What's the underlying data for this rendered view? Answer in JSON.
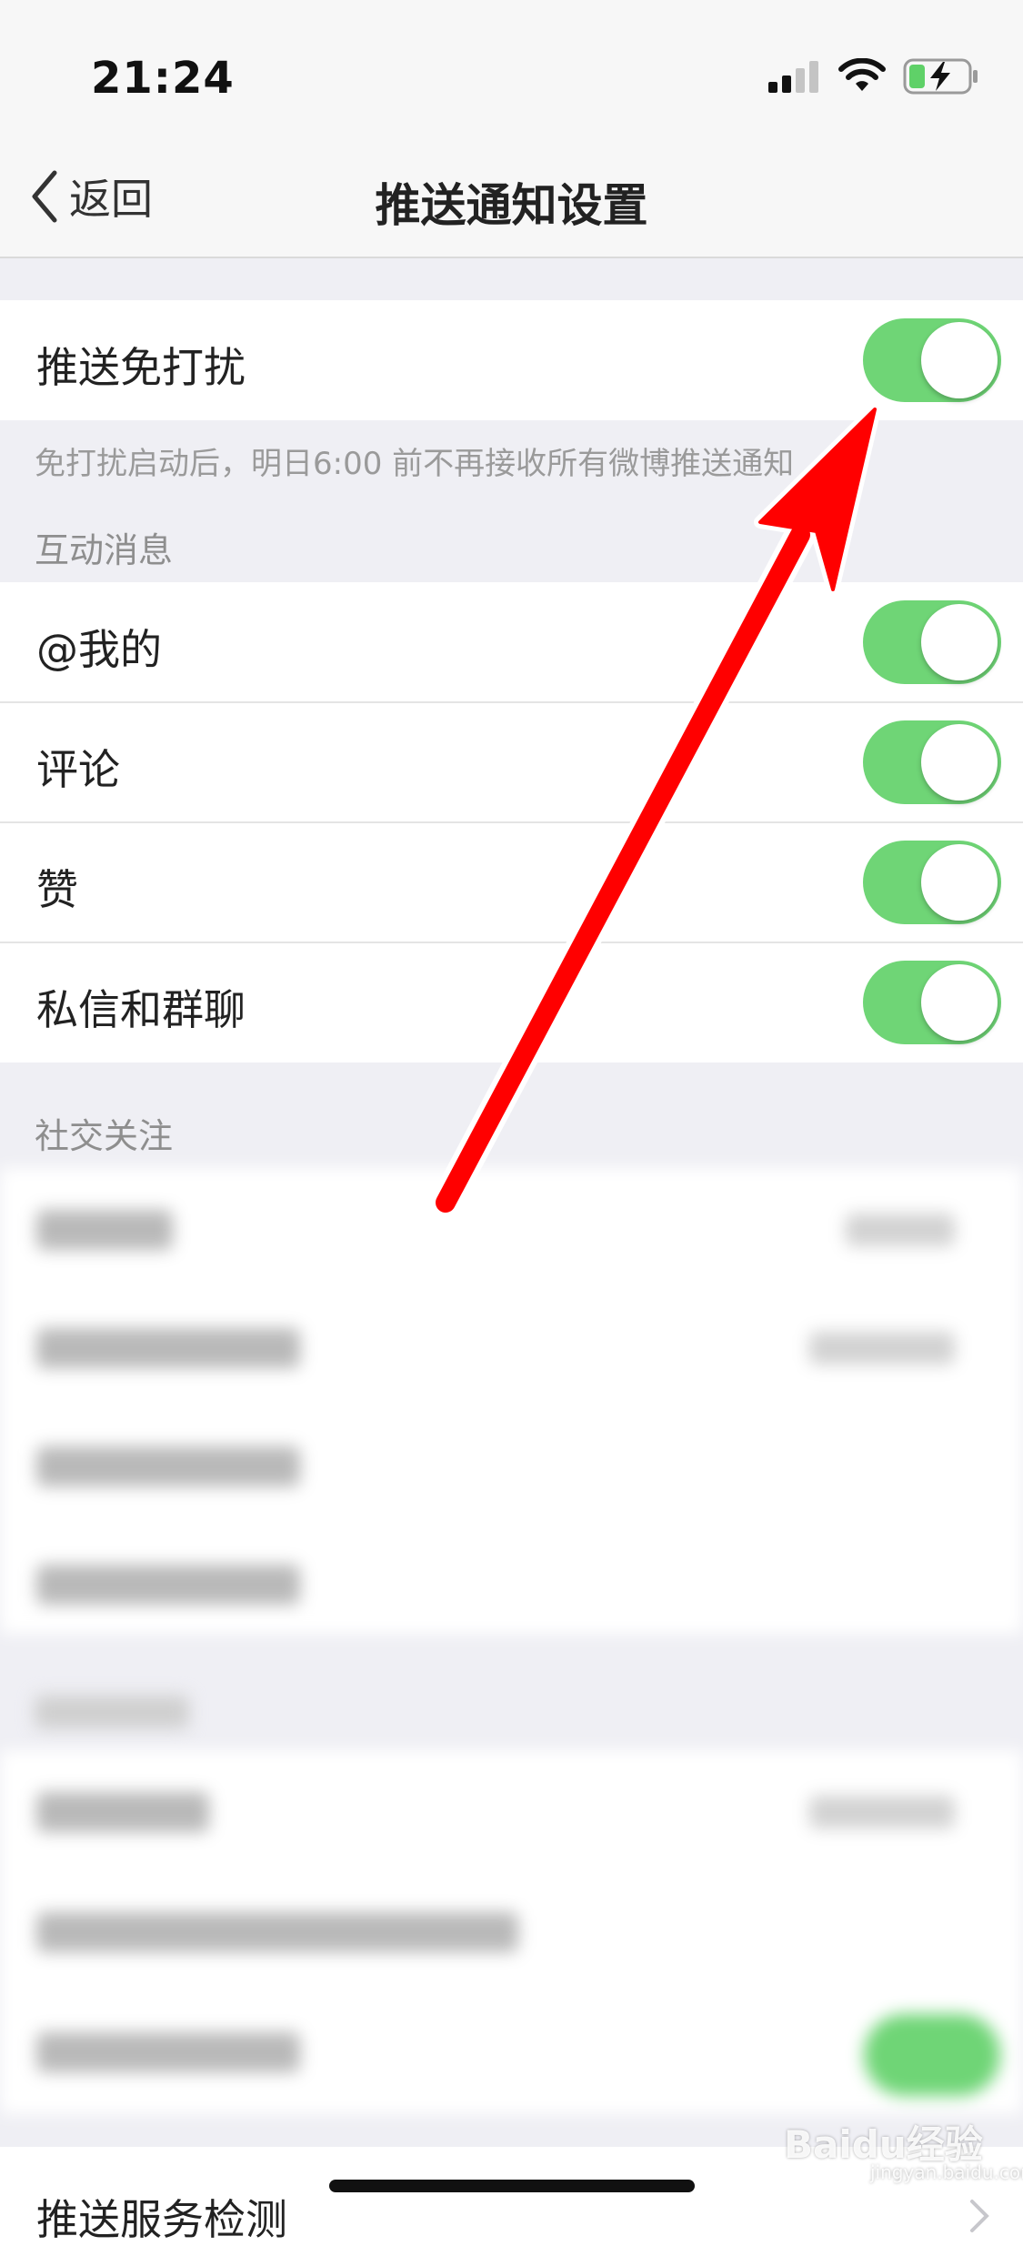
{
  "status_bar": {
    "time": "21:24"
  },
  "nav": {
    "back_label": "返回",
    "title": "推送通知设置"
  },
  "dnd": {
    "label": "推送免打扰",
    "enabled": true,
    "note": "免打扰启动后，明日6:00 前不再接收所有微博推送通知"
  },
  "interaction": {
    "header": "互动消息",
    "items": [
      {
        "label": "@我的",
        "enabled": true
      },
      {
        "label": "评论",
        "enabled": true
      },
      {
        "label": "赞",
        "enabled": true
      },
      {
        "label": "私信和群聊",
        "enabled": true
      }
    ]
  },
  "social": {
    "header": "社交关注"
  },
  "bottom": {
    "label": "推送服务检测"
  },
  "watermark": {
    "brand": "Baidu经验",
    "site": "jingyan.baidu.com"
  },
  "colors": {
    "toggle_on": "#6fd576",
    "annotation_arrow": "#ff0000",
    "background": "#efeff4"
  },
  "icons": {
    "back": "chevron-left-icon",
    "signal": "cellular-signal-icon",
    "wifi": "wifi-icon",
    "battery": "battery-charging-icon",
    "annotation": "red-arrow-icon"
  }
}
